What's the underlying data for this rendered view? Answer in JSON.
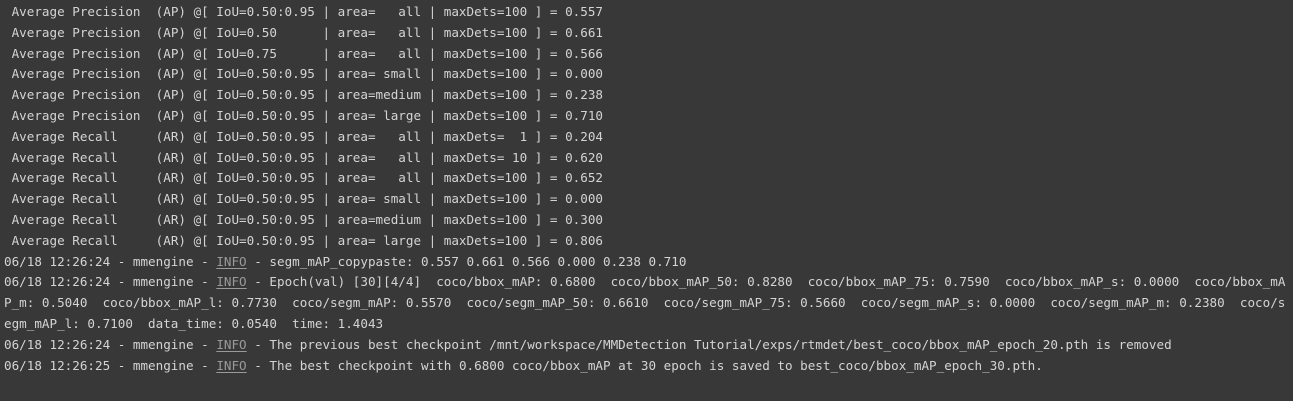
{
  "console": {
    "lines": [
      {
        "text": " Average Precision  (AP) @[ IoU=0.50:0.95 | area=   all | maxDets=100 ] = 0.557"
      },
      {
        "text": " Average Precision  (AP) @[ IoU=0.50      | area=   all | maxDets=100 ] = 0.661"
      },
      {
        "text": " Average Precision  (AP) @[ IoU=0.75      | area=   all | maxDets=100 ] = 0.566"
      },
      {
        "text": " Average Precision  (AP) @[ IoU=0.50:0.95 | area= small | maxDets=100 ] = 0.000"
      },
      {
        "text": " Average Precision  (AP) @[ IoU=0.50:0.95 | area=medium | maxDets=100 ] = 0.238"
      },
      {
        "text": " Average Precision  (AP) @[ IoU=0.50:0.95 | area= large | maxDets=100 ] = 0.710"
      },
      {
        "text": " Average Recall     (AR) @[ IoU=0.50:0.95 | area=   all | maxDets=  1 ] = 0.204"
      },
      {
        "text": " Average Recall     (AR) @[ IoU=0.50:0.95 | area=   all | maxDets= 10 ] = 0.620"
      },
      {
        "text": " Average Recall     (AR) @[ IoU=0.50:0.95 | area=   all | maxDets=100 ] = 0.652"
      },
      {
        "text": " Average Recall     (AR) @[ IoU=0.50:0.95 | area= small | maxDets=100 ] = 0.000"
      },
      {
        "text": " Average Recall     (AR) @[ IoU=0.50:0.95 | area=medium | maxDets=100 ] = 0.300"
      },
      {
        "text": " Average Recall     (AR) @[ IoU=0.50:0.95 | area= large | maxDets=100 ] = 0.806"
      },
      {
        "prefix": "06/18 12:26:24 - mmengine - ",
        "level": "INFO",
        "message": " - segm_mAP_copypaste: 0.557 0.661 0.566 0.000 0.238 0.710"
      },
      {
        "prefix": "06/18 12:26:24 - mmengine - ",
        "level": "INFO",
        "message": " - Epoch(val) [30][4/4]  coco/bbox_mAP: 0.6800  coco/bbox_mAP_50: 0.8280  coco/bbox_mAP_75: 0.7590  coco/bbox_mAP_s: 0.0000  coco/bbox_mAP_m: 0.5040  coco/bbox_mAP_l: 0.7730  coco/segm_mAP: 0.5570  coco/segm_mAP_50: 0.6610  coco/segm_mAP_75: 0.5660  coco/segm_mAP_s: 0.0000  coco/segm_mAP_m: 0.2380  coco/segm_mAP_l: 0.7100  data_time: 0.0540  time: 1.4043"
      },
      {
        "prefix": "06/18 12:26:24 - mmengine - ",
        "level": "INFO",
        "message": " - The previous best checkpoint /mnt/workspace/MMDetection Tutorial/exps/rtmdet/best_coco/bbox_mAP_epoch_20.pth is removed"
      },
      {
        "prefix": "06/18 12:26:25 - mmengine - ",
        "level": "INFO",
        "message": " - The best checkpoint with 0.6800 coco/bbox_mAP at 30 epoch is saved to best_coco/bbox_mAP_epoch_30.pth."
      }
    ]
  }
}
